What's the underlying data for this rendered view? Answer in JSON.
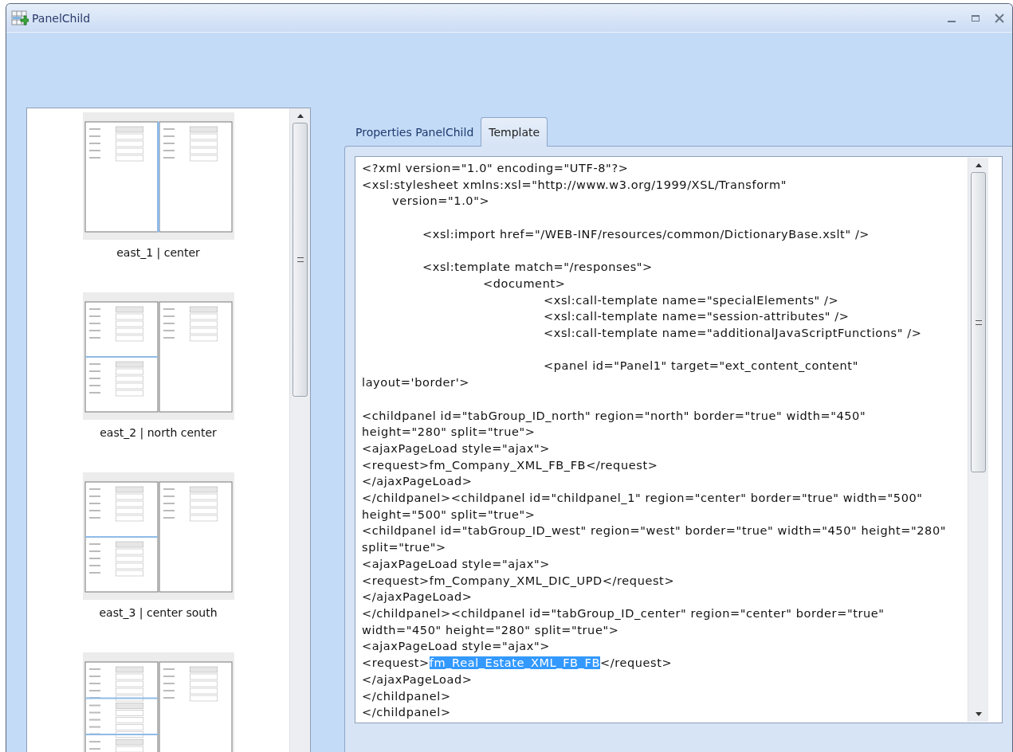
{
  "window": {
    "title": "PanelChild"
  },
  "layouts": [
    {
      "kind": "two-column",
      "label": "east_1 | center"
    },
    {
      "kind": "left-two-stack",
      "label": "east_2 | north center"
    },
    {
      "kind": "left-two-stack-low",
      "label": "east_3 | center south"
    },
    {
      "kind": "left-three-stack"
    }
  ],
  "tabs": [
    {
      "label": "Properties PanelChild",
      "selected": false
    },
    {
      "label": "Template",
      "selected": true
    }
  ],
  "editor": {
    "content": [
      {
        "text": "<?xml version=\"1.0\" encoding=\"UTF-8\"?>\n<xsl:stylesheet xmlns:xsl=\"http://www.w3.org/1999/XSL/Transform\"\n\tversion=\"1.0\">\n\n\t\t<xsl:import href=\"/WEB-INF/resources/common/DictionaryBase.xslt\" />\n\n\t\t<xsl:template match=\"/responses\">\n\t\t\t\t<document>\n\t\t\t\t\t\t<xsl:call-template name=\"specialElements\" />\n\t\t\t\t\t\t<xsl:call-template name=\"session-attributes\" />\n\t\t\t\t\t\t<xsl:call-template name=\"additionalJavaScriptFunctions\" />\n\n\t\t\t\t\t\t<panel id=\"Panel1\" target=\"ext_content_content\"\nlayout='border'>\n\n<childpanel id=\"tabGroup_ID_north\" region=\"north\" border=\"true\" width=\"450\"\nheight=\"280\" split=\"true\">\n<ajaxPageLoad style=\"ajax\">\n<request>fm_Company_XML_FB_FB</request>\n</ajaxPageLoad>\n</childpanel><childpanel id=\"childpanel_1\" region=\"center\" border=\"true\" width=\"500\"\nheight=\"500\" split=\"true\">\n<childpanel id=\"tabGroup_ID_west\" region=\"west\" border=\"true\" width=\"450\" height=\"280\"\nsplit=\"true\">\n<ajaxPageLoad style=\"ajax\">\n<request>fm_Company_XML_DIC_UPD</request>\n</ajaxPageLoad>\n</childpanel><childpanel id=\"tabGroup_ID_center\" region=\"center\" border=\"true\"\nwidth=\"450\" height=\"280\" split=\"true\">\n<ajaxPageLoad style=\"ajax\">\n<request>",
        "selected": false
      },
      {
        "text": "fm_Real_Estate_XML_FB_FB",
        "selected": true
      },
      {
        "text": "</request>\n</ajaxPageLoad>\n</childpanel>\n</childpanel>",
        "selected": false
      }
    ]
  }
}
